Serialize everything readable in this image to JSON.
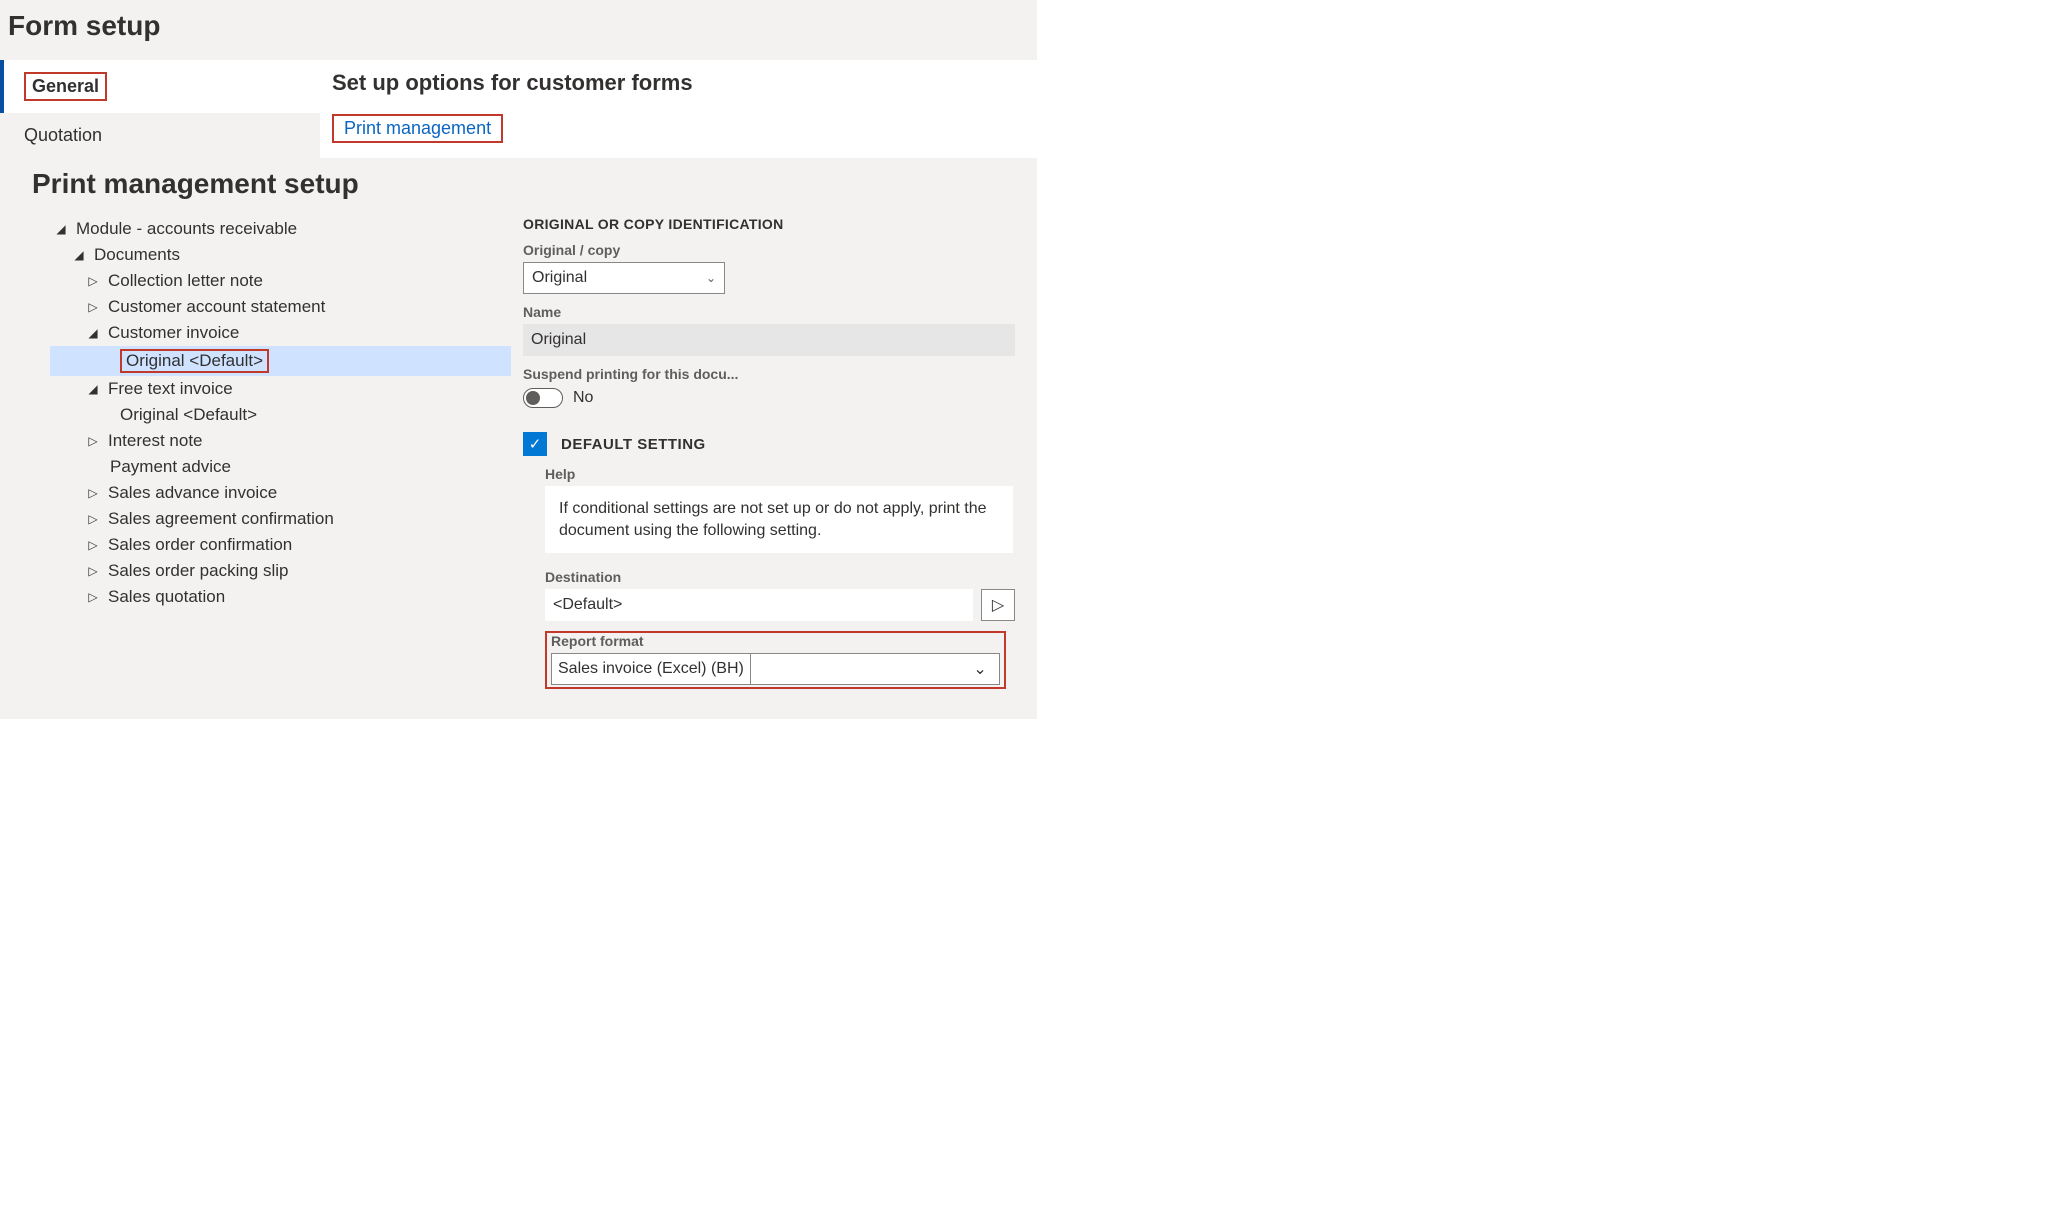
{
  "header": {
    "page_title": "Form setup"
  },
  "side_tabs": {
    "general": "General",
    "quotation": "Quotation"
  },
  "main": {
    "heading": "Set up options for customer forms",
    "print_mgmt_link": "Print management"
  },
  "pm": {
    "title": "Print management setup",
    "tree": {
      "module": "Module - accounts receivable",
      "documents": "Documents",
      "collection_letter_note": "Collection letter note",
      "customer_account_statement": "Customer account statement",
      "customer_invoice": "Customer invoice",
      "customer_invoice_original": "Original <Default>",
      "free_text_invoice": "Free text invoice",
      "free_text_invoice_original": "Original <Default>",
      "interest_note": "Interest note",
      "payment_advice": "Payment advice",
      "sales_advance_invoice": "Sales advance invoice",
      "sales_agreement_confirmation": "Sales agreement confirmation",
      "sales_order_confirmation": "Sales order confirmation",
      "sales_order_packing_slip": "Sales order packing slip",
      "sales_quotation": "Sales quotation"
    },
    "form": {
      "section_head": "ORIGINAL OR COPY IDENTIFICATION",
      "original_copy_label": "Original / copy",
      "original_copy_value": "Original",
      "name_label": "Name",
      "name_value": "Original",
      "suspend_label": "Suspend printing for this docu...",
      "suspend_value": "No",
      "default_setting_label": "DEFAULT SETTING",
      "help_label": "Help",
      "help_text": "If conditional settings are not set up or do not apply, print the document using the following setting.",
      "destination_label": "Destination",
      "destination_value": "<Default>",
      "report_format_label": "Report format",
      "report_format_value": "Sales invoice (Excel) (BH)"
    }
  }
}
